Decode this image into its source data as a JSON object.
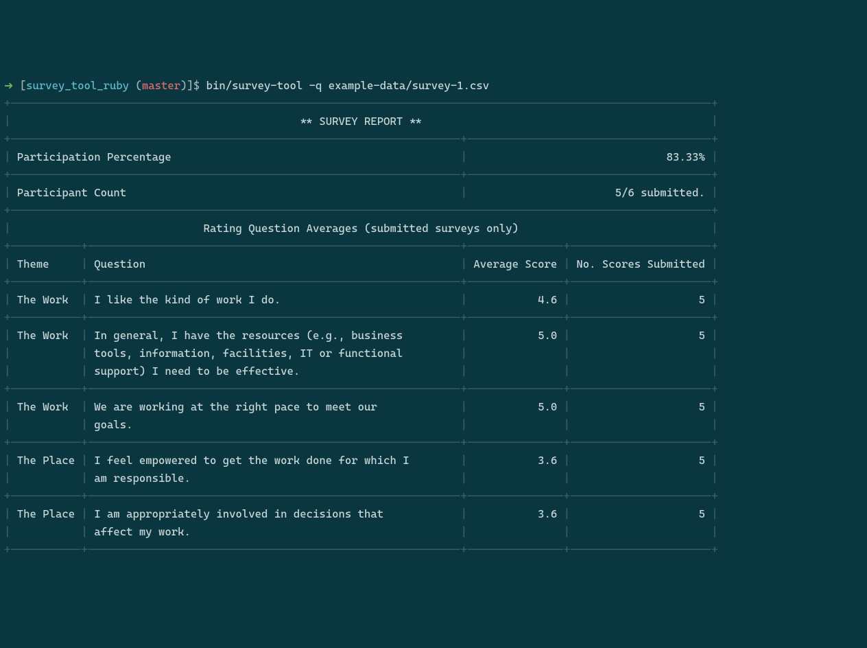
{
  "prompt": {
    "arrow": "➜",
    "lb": "[",
    "dir": "survey_tool_ruby",
    "lp": " (",
    "branch": "master",
    "rp": ")",
    "rb": "]",
    "dollar": "$ ",
    "command": "bin/survey-tool -q example-data/survey-1.csv"
  },
  "title": "** SURVEY REPORT **",
  "participation_label": "Participation Percentage",
  "participation_value": "83.33%",
  "count_label": "Participant Count",
  "count_value": "5/6 submitted.",
  "section_header": "Rating Question Averages (submitted surveys only)",
  "col_theme": "Theme",
  "col_question": "Question",
  "col_avg": "Average Score",
  "col_num": "No. Scores Submitted",
  "rows": [
    {
      "theme": "The Work",
      "q1": "I like the kind of work I do.",
      "avg": "4.6",
      "n": "5"
    },
    {
      "theme": "The Work",
      "q1": "In general, I have the resources (e.g., business",
      "q2": "tools, information, facilities, IT or functional",
      "q3": "support) I need to be effective.",
      "avg": "5.0",
      "n": "5"
    },
    {
      "theme": "The Work",
      "q1": "We are working at the right pace to meet our",
      "q2": "goals.",
      "avg": "5.0",
      "n": "5"
    },
    {
      "theme": "The Place",
      "q1": "I feel empowered to get the work done for which I",
      "q2": "am responsible.",
      "avg": "3.6",
      "n": "5"
    },
    {
      "theme": "The Place",
      "q1": "I am appropriately involved in decisions that",
      "q2": "affect my work.",
      "avg": "3.6",
      "n": "5"
    }
  ],
  "chart_data": {
    "type": "table",
    "title": "Rating Question Averages (submitted surveys only)",
    "columns": [
      "Theme",
      "Question",
      "Average Score",
      "No. Scores Submitted"
    ],
    "rows": [
      [
        "The Work",
        "I like the kind of work I do.",
        4.6,
        5
      ],
      [
        "The Work",
        "In general, I have the resources (e.g., business tools, information, facilities, IT or functional support) I need to be effective.",
        5.0,
        5
      ],
      [
        "The Work",
        "We are working at the right pace to meet our goals.",
        5.0,
        5
      ],
      [
        "The Place",
        "I feel empowered to get the work done for which I am responsible.",
        3.6,
        5
      ],
      [
        "The Place",
        "I am appropriately involved in decisions that affect my work.",
        3.6,
        5
      ]
    ],
    "participation_percentage": 83.33,
    "participant_count": "5/6 submitted."
  }
}
